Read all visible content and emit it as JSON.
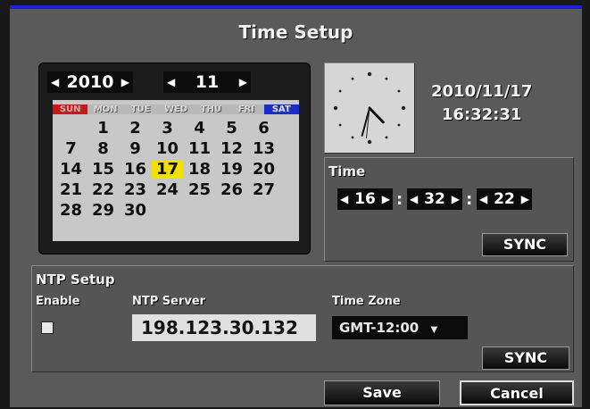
{
  "window": {
    "title": "Time Setup"
  },
  "calendar": {
    "year": "2010",
    "month": "11",
    "weekdays": [
      "SUN",
      "MON",
      "TUE",
      "WED",
      "THU",
      "FRI",
      "SAT"
    ],
    "days": [
      "1",
      "2",
      "3",
      "4",
      "5",
      "6",
      "7",
      "8",
      "9",
      "10",
      "11",
      "12",
      "13",
      "14",
      "15",
      "16",
      "17",
      "18",
      "19",
      "20",
      "21",
      "22",
      "23",
      "24",
      "25",
      "26",
      "27",
      "28",
      "29",
      "30"
    ],
    "selected_day": "17"
  },
  "clock": {
    "date": "2010/11/17",
    "time": "16:32:31"
  },
  "time_panel": {
    "label": "Time",
    "hour": "16",
    "minute": "32",
    "second": "22",
    "sep": ":",
    "sync_label": "SYNC"
  },
  "ntp": {
    "title": "NTP Setup",
    "enable_label": "Enable",
    "server_label": "NTP Server",
    "server_value": "198.123.30.132",
    "timezone_label": "Time Zone",
    "timezone_value": "GMT-12:00",
    "sync_label": "SYNC",
    "enabled": false
  },
  "footer": {
    "save_label": "Save",
    "cancel_label": "Cancel"
  },
  "colors": {
    "title_bar_accent": "#1f1fd8",
    "selected_day": "#f0e000",
    "sunday": "#c81818",
    "saturday": "#1c2cc8"
  }
}
